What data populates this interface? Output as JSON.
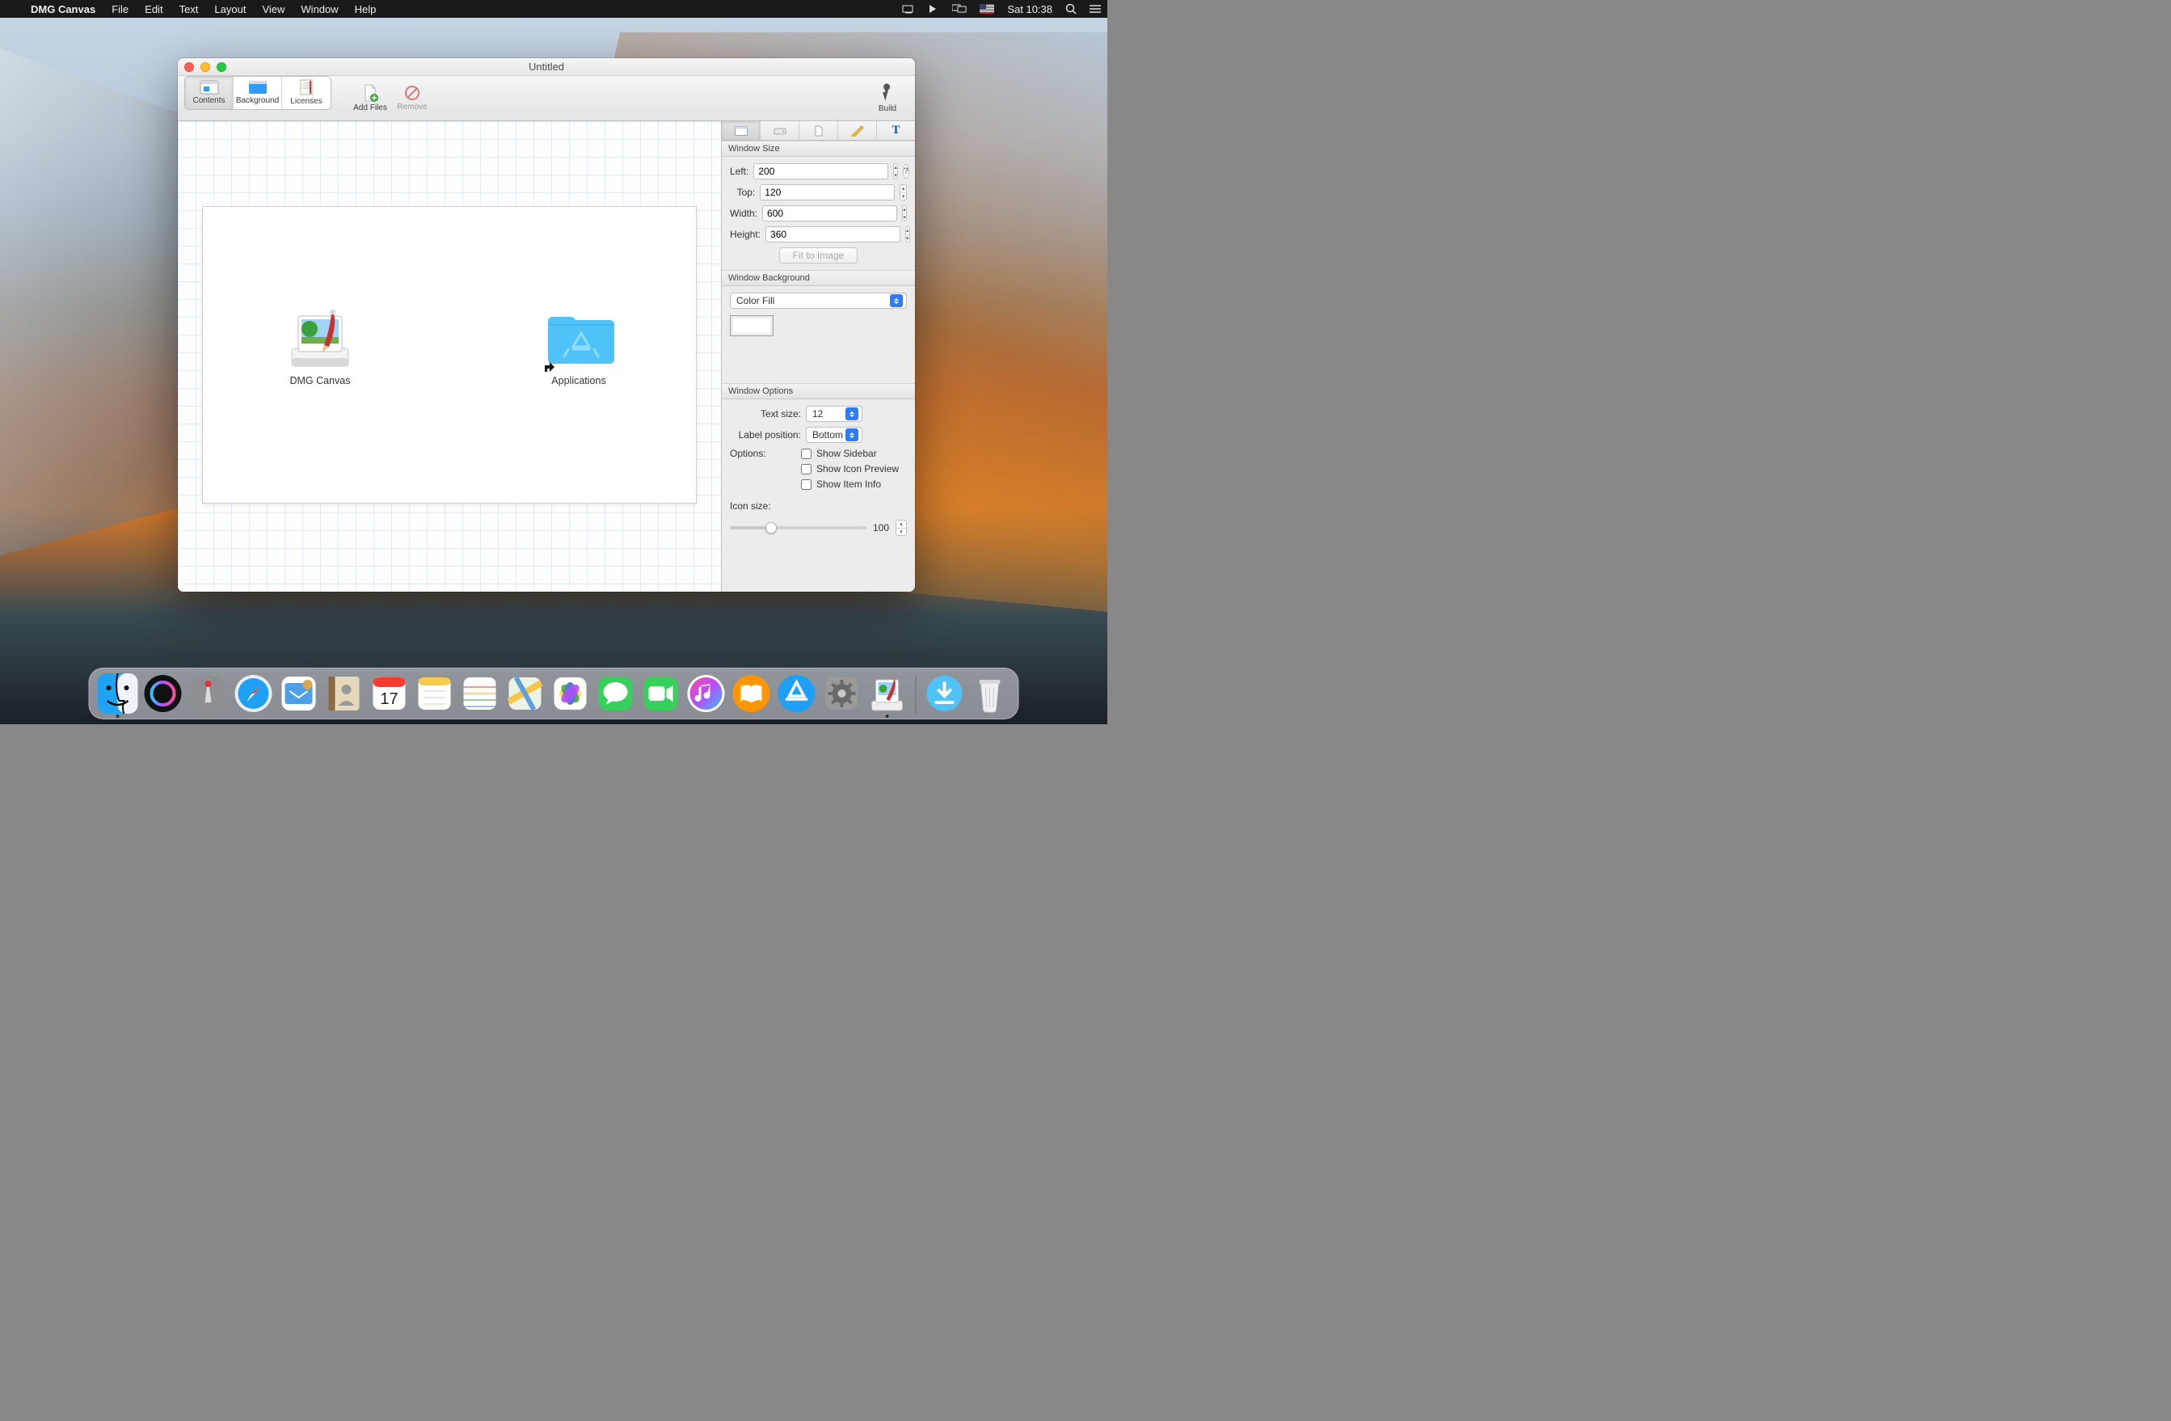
{
  "menubar": {
    "app_name": "DMG Canvas",
    "items": [
      "File",
      "Edit",
      "Text",
      "Layout",
      "View",
      "Window",
      "Help"
    ],
    "clock": "Sat 10:38"
  },
  "window": {
    "title": "Untitled",
    "toolbar": {
      "contents": "Contents",
      "background": "Background",
      "licenses": "Licenses",
      "add_files": "Add Files",
      "remove": "Remove",
      "build": "Build"
    },
    "canvas": {
      "items": [
        {
          "label": "DMG Canvas"
        },
        {
          "label": "Applications"
        }
      ]
    },
    "inspector": {
      "window_size": {
        "heading": "Window Size",
        "left_label": "Left:",
        "left": "200",
        "top_label": "Top:",
        "top": "120",
        "width_label": "Width:",
        "width": "600",
        "height_label": "Height:",
        "height": "360",
        "fit": "Fit to Image"
      },
      "window_background": {
        "heading": "Window Background",
        "mode": "Color Fill"
      },
      "window_options": {
        "heading": "Window Options",
        "text_size_label": "Text size:",
        "text_size": "12",
        "label_pos_label": "Label position:",
        "label_pos": "Bottom",
        "options_label": "Options:",
        "show_sidebar": "Show Sidebar",
        "show_icon_preview": "Show Icon Preview",
        "show_item_info": "Show Item Info",
        "icon_size_label": "Icon size:",
        "icon_size": "100"
      }
    }
  },
  "dock": {
    "items": [
      "finder",
      "siri",
      "launchpad",
      "safari",
      "mail",
      "contacts",
      "calendar",
      "notes",
      "reminders",
      "maps",
      "photos",
      "messages",
      "facetime",
      "itunes",
      "ibooks",
      "appstore",
      "preferences",
      "dmgcanvas"
    ],
    "right_items": [
      "downloads",
      "trash"
    ]
  }
}
